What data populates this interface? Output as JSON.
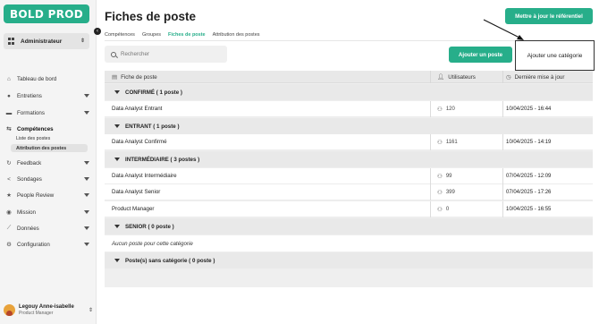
{
  "brand": {
    "logo": "BOLD PROD",
    "accent": "#27ae8a"
  },
  "sidebar": {
    "role": "Administrateur",
    "items": [
      {
        "label": "Tableau de bord",
        "icon": "home-icon"
      },
      {
        "label": "Entretiens",
        "icon": "chat-icon"
      },
      {
        "label": "Formations",
        "icon": "book-icon"
      },
      {
        "label": "Compétences",
        "icon": "skills-icon"
      },
      {
        "label": "Feedback",
        "icon": "refresh-icon"
      },
      {
        "label": "Sondages",
        "icon": "share-icon"
      },
      {
        "label": "People Review",
        "icon": "star-icon"
      },
      {
        "label": "Mission",
        "icon": "target-icon"
      },
      {
        "label": "Données",
        "icon": "chart-icon"
      },
      {
        "label": "Configuration",
        "icon": "gear-icon"
      }
    ],
    "sub_items": [
      {
        "label": "Liste des postes"
      },
      {
        "label": "Attribution des postes"
      }
    ]
  },
  "user": {
    "name": "Legouy Anne-isabelle",
    "role": "Product Manager"
  },
  "header": {
    "title": "Fiches de poste",
    "update_button": "Mettre à jour le référentiel"
  },
  "tabs": [
    "Compétences",
    "Groupes",
    "Fiches de poste",
    "Attribution des postes"
  ],
  "toolbar": {
    "search_placeholder": "Rechercher",
    "add_poste": "Ajouter un poste",
    "add_category": "Ajouter une catégorie"
  },
  "table": {
    "columns": [
      "Fiche de poste",
      "Utilisateurs",
      "Dernière mise à jour"
    ],
    "categories": [
      {
        "label": "CONFIRMÉ ( 1 poste )",
        "rows": [
          {
            "name": "Data Analyst Entrant",
            "users": "120",
            "updated": "10/04/2025 - 16:44"
          }
        ]
      },
      {
        "label": "ENTRANT ( 1 poste )",
        "rows": [
          {
            "name": "Data Analyst Confirmé",
            "users": "1161",
            "updated": "10/04/2025 - 14:19"
          }
        ]
      },
      {
        "label": "INTERMÉDIAIRE ( 3 postes )",
        "rows": [
          {
            "name": "Data Analyst Intermédiaire",
            "users": "99",
            "updated": "07/04/2025 - 12:09"
          },
          {
            "name": "Data Analyst Senior",
            "users": "399",
            "updated": "07/04/2025 - 17:26"
          },
          {
            "name": "Product Manager",
            "users": "0",
            "updated": "10/04/2025 - 16:55"
          }
        ]
      },
      {
        "label": "SENIOR ( 0 poste )",
        "empty": "Aucun poste pour cette catégorie"
      },
      {
        "label": "Poste(s) sans catégorie ( 0 poste )"
      }
    ]
  }
}
